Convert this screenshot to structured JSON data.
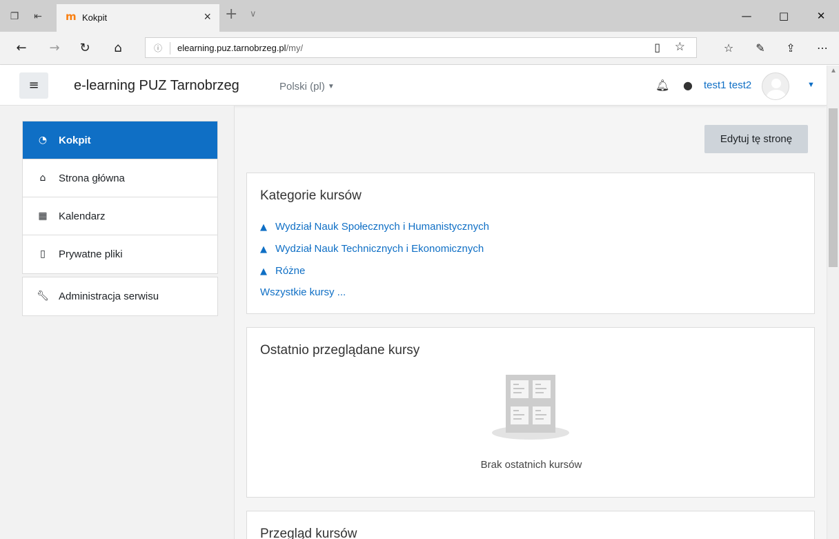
{
  "browser": {
    "tab_title": "Kokpit",
    "favicon_glyph": "m",
    "url_host": "elearning.puz.tarnobrzeg.pl",
    "url_path": "/my/"
  },
  "navbar": {
    "brand": "e-learning PUZ Tarnobrzeg",
    "language": "Polski (pl)",
    "user_name": "test1 test2"
  },
  "drawer": {
    "items": [
      {
        "label": "Kokpit",
        "icon": "dashboard-icon",
        "active": true
      },
      {
        "label": "Strona główna",
        "icon": "home-icon",
        "active": false
      },
      {
        "label": "Kalendarz",
        "icon": "calendar-icon",
        "active": false
      },
      {
        "label": "Prywatne pliki",
        "icon": "file-icon",
        "active": false
      }
    ],
    "admin_item": {
      "label": "Administracja serwisu",
      "icon": "wrench-icon"
    }
  },
  "main": {
    "edit_button": "Edytuj tę stronę",
    "categories_card": {
      "title": "Kategorie kursów",
      "links": [
        "Wydział Nauk Społecznych i Humanistycznych",
        "Wydział Nauk Technicznych i Ekonomicznych",
        "Różne"
      ],
      "all_courses": "Wszystkie kursy ..."
    },
    "recent_card": {
      "title": "Ostatnio przeglądane kursy",
      "empty_text": "Brak ostatnich kursów"
    },
    "overview_card": {
      "title": "Przegląd kursów"
    }
  },
  "colors": {
    "accent": "#0f6fc5",
    "moodle_orange": "#f98012"
  }
}
